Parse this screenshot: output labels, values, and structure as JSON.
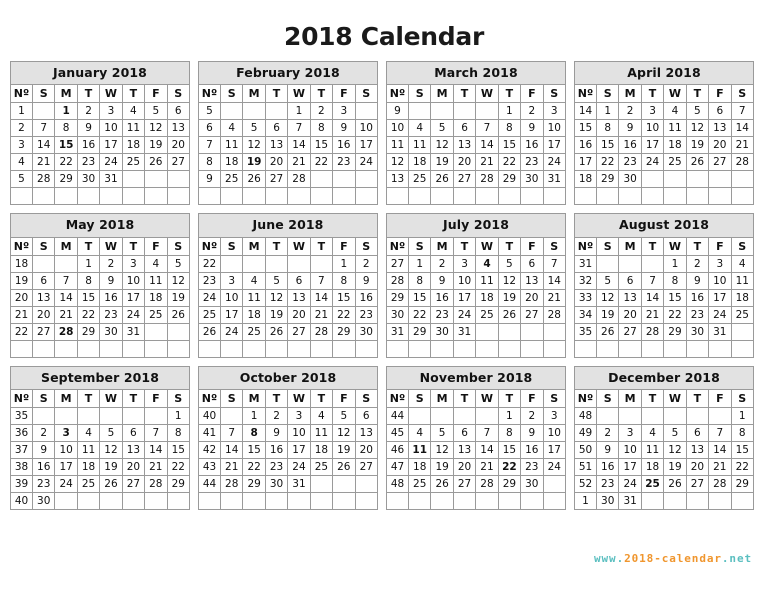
{
  "title": "2018 Calendar",
  "footer": {
    "prefix": "www.",
    "middle": "2018-calendar",
    "suffix": ".net",
    "full": "www.2018-calendar.net",
    "color_teal": "#5bbfc0",
    "color_orange": "#f0962e"
  },
  "colors": {
    "header_bg": "#e2e2e2",
    "border": "#9a9a9a",
    "week_number": "#11218b",
    "sunday": "#bb4b4b",
    "saturday": "#c9ab52",
    "holiday": "#c0201c",
    "weekend_bg": "#f1f1f1"
  },
  "weekday_headers": [
    "Nº",
    "S",
    "M",
    "T",
    "W",
    "T",
    "F",
    "S"
  ],
  "months": [
    {
      "name": "January 2018",
      "weeks": [
        {
          "no": "1",
          "days": [
            "",
            "1",
            "2",
            "3",
            "4",
            "5",
            "6"
          ],
          "holidays": [
            "1"
          ]
        },
        {
          "no": "2",
          "days": [
            "7",
            "8",
            "9",
            "10",
            "11",
            "12",
            "13"
          ],
          "holidays": []
        },
        {
          "no": "3",
          "days": [
            "14",
            "15",
            "16",
            "17",
            "18",
            "19",
            "20"
          ],
          "holidays": [
            "15"
          ]
        },
        {
          "no": "4",
          "days": [
            "21",
            "22",
            "23",
            "24",
            "25",
            "26",
            "27"
          ],
          "holidays": []
        },
        {
          "no": "5",
          "days": [
            "28",
            "29",
            "30",
            "31",
            "",
            "",
            ""
          ],
          "holidays": []
        },
        {
          "no": "",
          "days": [
            "",
            "",
            "",
            "",
            "",
            "",
            ""
          ],
          "holidays": []
        }
      ]
    },
    {
      "name": "February 2018",
      "weeks": [
        {
          "no": "5",
          "days": [
            "",
            "",
            "",
            "1",
            "2",
            "3",
            ""
          ],
          "holidays": [],
          "shift": 4
        },
        {
          "no": "6",
          "days": [
            "4",
            "5",
            "6",
            "7",
            "8",
            "9",
            "10"
          ],
          "holidays": []
        },
        {
          "no": "7",
          "days": [
            "11",
            "12",
            "13",
            "14",
            "15",
            "16",
            "17"
          ],
          "holidays": []
        },
        {
          "no": "8",
          "days": [
            "18",
            "19",
            "20",
            "21",
            "22",
            "23",
            "24"
          ],
          "holidays": [
            "19"
          ]
        },
        {
          "no": "9",
          "days": [
            "25",
            "26",
            "27",
            "28",
            "",
            "",
            ""
          ],
          "holidays": []
        },
        {
          "no": "",
          "days": [
            "",
            "",
            "",
            "",
            "",
            "",
            ""
          ],
          "holidays": []
        }
      ]
    },
    {
      "name": "March 2018",
      "weeks": [
        {
          "no": "9",
          "days": [
            "",
            "",
            "",
            "",
            "1",
            "2",
            "3"
          ],
          "holidays": []
        },
        {
          "no": "10",
          "days": [
            "4",
            "5",
            "6",
            "7",
            "8",
            "9",
            "10"
          ],
          "holidays": []
        },
        {
          "no": "11",
          "days": [
            "11",
            "12",
            "13",
            "14",
            "15",
            "16",
            "17"
          ],
          "holidays": []
        },
        {
          "no": "12",
          "days": [
            "18",
            "19",
            "20",
            "21",
            "22",
            "23",
            "24"
          ],
          "holidays": []
        },
        {
          "no": "13",
          "days": [
            "25",
            "26",
            "27",
            "28",
            "29",
            "30",
            "31"
          ],
          "holidays": []
        },
        {
          "no": "",
          "days": [
            "",
            "",
            "",
            "",
            "",
            "",
            ""
          ],
          "holidays": []
        }
      ]
    },
    {
      "name": "April 2018",
      "weeks": [
        {
          "no": "14",
          "days": [
            "1",
            "2",
            "3",
            "4",
            "5",
            "6",
            "7"
          ],
          "holidays": []
        },
        {
          "no": "15",
          "days": [
            "8",
            "9",
            "10",
            "11",
            "12",
            "13",
            "14"
          ],
          "holidays": []
        },
        {
          "no": "16",
          "days": [
            "15",
            "16",
            "17",
            "18",
            "19",
            "20",
            "21"
          ],
          "holidays": []
        },
        {
          "no": "17",
          "days": [
            "22",
            "23",
            "24",
            "25",
            "26",
            "27",
            "28"
          ],
          "holidays": []
        },
        {
          "no": "18",
          "days": [
            "29",
            "30",
            "",
            "",
            "",
            "",
            ""
          ],
          "holidays": []
        },
        {
          "no": "",
          "days": [
            "",
            "",
            "",
            "",
            "",
            "",
            ""
          ],
          "holidays": []
        }
      ]
    },
    {
      "name": "May 2018",
      "weeks": [
        {
          "no": "18",
          "days": [
            "",
            "",
            "1",
            "2",
            "3",
            "4",
            "5"
          ],
          "holidays": []
        },
        {
          "no": "19",
          "days": [
            "6",
            "7",
            "8",
            "9",
            "10",
            "11",
            "12"
          ],
          "holidays": []
        },
        {
          "no": "20",
          "days": [
            "13",
            "14",
            "15",
            "16",
            "17",
            "18",
            "19"
          ],
          "holidays": []
        },
        {
          "no": "21",
          "days": [
            "20",
            "21",
            "22",
            "23",
            "24",
            "25",
            "26"
          ],
          "holidays": []
        },
        {
          "no": "22",
          "days": [
            "27",
            "28",
            "29",
            "30",
            "31",
            "",
            ""
          ],
          "holidays": [
            "28"
          ]
        },
        {
          "no": "",
          "days": [
            "",
            "",
            "",
            "",
            "",
            "",
            ""
          ],
          "holidays": []
        }
      ]
    },
    {
      "name": "June 2018",
      "weeks": [
        {
          "no": "22",
          "days": [
            "",
            "",
            "",
            "",
            "",
            "1",
            "2"
          ],
          "holidays": []
        },
        {
          "no": "23",
          "days": [
            "3",
            "4",
            "5",
            "6",
            "7",
            "8",
            "9"
          ],
          "holidays": []
        },
        {
          "no": "24",
          "days": [
            "10",
            "11",
            "12",
            "13",
            "14",
            "15",
            "16"
          ],
          "holidays": []
        },
        {
          "no": "25",
          "days": [
            "17",
            "18",
            "19",
            "20",
            "21",
            "22",
            "23"
          ],
          "holidays": []
        },
        {
          "no": "26",
          "days": [
            "24",
            "25",
            "26",
            "27",
            "28",
            "29",
            "30"
          ],
          "holidays": []
        },
        {
          "no": "",
          "days": [
            "",
            "",
            "",
            "",
            "",
            "",
            ""
          ],
          "holidays": []
        }
      ]
    },
    {
      "name": "July 2018",
      "weeks": [
        {
          "no": "27",
          "days": [
            "1",
            "2",
            "3",
            "4",
            "5",
            "6",
            "7"
          ],
          "holidays": [
            "4"
          ]
        },
        {
          "no": "28",
          "days": [
            "8",
            "9",
            "10",
            "11",
            "12",
            "13",
            "14"
          ],
          "holidays": []
        },
        {
          "no": "29",
          "days": [
            "15",
            "16",
            "17",
            "18",
            "19",
            "20",
            "21"
          ],
          "holidays": []
        },
        {
          "no": "30",
          "days": [
            "22",
            "23",
            "24",
            "25",
            "26",
            "27",
            "28"
          ],
          "holidays": []
        },
        {
          "no": "31",
          "days": [
            "29",
            "30",
            "31",
            "",
            "",
            "",
            ""
          ],
          "holidays": []
        },
        {
          "no": "",
          "days": [
            "",
            "",
            "",
            "",
            "",
            "",
            ""
          ],
          "holidays": []
        }
      ]
    },
    {
      "name": "August 2018",
      "weeks": [
        {
          "no": "31",
          "days": [
            "",
            "",
            "",
            "1",
            "2",
            "3",
            "4"
          ],
          "holidays": []
        },
        {
          "no": "32",
          "days": [
            "5",
            "6",
            "7",
            "8",
            "9",
            "10",
            "11"
          ],
          "holidays": []
        },
        {
          "no": "33",
          "days": [
            "12",
            "13",
            "14",
            "15",
            "16",
            "17",
            "18"
          ],
          "holidays": []
        },
        {
          "no": "34",
          "days": [
            "19",
            "20",
            "21",
            "22",
            "23",
            "24",
            "25"
          ],
          "holidays": []
        },
        {
          "no": "35",
          "days": [
            "26",
            "27",
            "28",
            "29",
            "30",
            "31",
            ""
          ],
          "holidays": []
        },
        {
          "no": "",
          "days": [
            "",
            "",
            "",
            "",
            "",
            "",
            ""
          ],
          "holidays": []
        }
      ]
    },
    {
      "name": "September 2018",
      "weeks": [
        {
          "no": "35",
          "days": [
            "",
            "",
            "",
            "",
            "",
            "",
            "1"
          ],
          "holidays": []
        },
        {
          "no": "36",
          "days": [
            "2",
            "3",
            "4",
            "5",
            "6",
            "7",
            "8"
          ],
          "holidays": [
            "3"
          ]
        },
        {
          "no": "37",
          "days": [
            "9",
            "10",
            "11",
            "12",
            "13",
            "14",
            "15"
          ],
          "holidays": []
        },
        {
          "no": "38",
          "days": [
            "16",
            "17",
            "18",
            "19",
            "20",
            "21",
            "22"
          ],
          "holidays": []
        },
        {
          "no": "39",
          "days": [
            "23",
            "24",
            "25",
            "26",
            "27",
            "28",
            "29"
          ],
          "holidays": []
        },
        {
          "no": "40",
          "days": [
            "30",
            "",
            "",
            "",
            "",
            "",
            ""
          ],
          "holidays": []
        }
      ]
    },
    {
      "name": "October 2018",
      "weeks": [
        {
          "no": "40",
          "days": [
            "",
            "1",
            "2",
            "3",
            "4",
            "5",
            "6"
          ],
          "holidays": []
        },
        {
          "no": "41",
          "days": [
            "7",
            "8",
            "9",
            "10",
            "11",
            "12",
            "13"
          ],
          "holidays": [
            "8"
          ]
        },
        {
          "no": "42",
          "days": [
            "14",
            "15",
            "16",
            "17",
            "18",
            "19",
            "20"
          ],
          "holidays": []
        },
        {
          "no": "43",
          "days": [
            "21",
            "22",
            "23",
            "24",
            "25",
            "26",
            "27"
          ],
          "holidays": []
        },
        {
          "no": "44",
          "days": [
            "28",
            "29",
            "30",
            "31",
            "",
            "",
            ""
          ],
          "holidays": []
        },
        {
          "no": "",
          "days": [
            "",
            "",
            "",
            "",
            "",
            "",
            ""
          ],
          "holidays": []
        }
      ]
    },
    {
      "name": "November 2018",
      "weeks": [
        {
          "no": "44",
          "days": [
            "",
            "",
            "",
            "",
            "1",
            "2",
            "3"
          ],
          "holidays": []
        },
        {
          "no": "45",
          "days": [
            "4",
            "5",
            "6",
            "7",
            "8",
            "9",
            "10"
          ],
          "holidays": []
        },
        {
          "no": "46",
          "days": [
            "11",
            "12",
            "13",
            "14",
            "15",
            "16",
            "17"
          ],
          "holidays": [
            "11"
          ]
        },
        {
          "no": "47",
          "days": [
            "18",
            "19",
            "20",
            "21",
            "22",
            "23",
            "24"
          ],
          "holidays": [
            "22"
          ]
        },
        {
          "no": "48",
          "days": [
            "25",
            "26",
            "27",
            "28",
            "29",
            "30",
            ""
          ],
          "holidays": []
        },
        {
          "no": "",
          "days": [
            "",
            "",
            "",
            "",
            "",
            "",
            ""
          ],
          "holidays": []
        }
      ]
    },
    {
      "name": "December 2018",
      "weeks": [
        {
          "no": "48",
          "days": [
            "",
            "",
            "",
            "",
            "",
            "",
            "1"
          ],
          "holidays": []
        },
        {
          "no": "49",
          "days": [
            "2",
            "3",
            "4",
            "5",
            "6",
            "7",
            "8"
          ],
          "holidays": []
        },
        {
          "no": "50",
          "days": [
            "9",
            "10",
            "11",
            "12",
            "13",
            "14",
            "15"
          ],
          "holidays": []
        },
        {
          "no": "51",
          "days": [
            "16",
            "17",
            "18",
            "19",
            "20",
            "21",
            "22"
          ],
          "holidays": []
        },
        {
          "no": "52",
          "days": [
            "23",
            "24",
            "25",
            "26",
            "27",
            "28",
            "29"
          ],
          "holidays": [
            "25"
          ]
        },
        {
          "no": "1",
          "days": [
            "30",
            "31",
            "",
            "",
            "",
            "",
            ""
          ],
          "holidays": []
        }
      ]
    }
  ]
}
